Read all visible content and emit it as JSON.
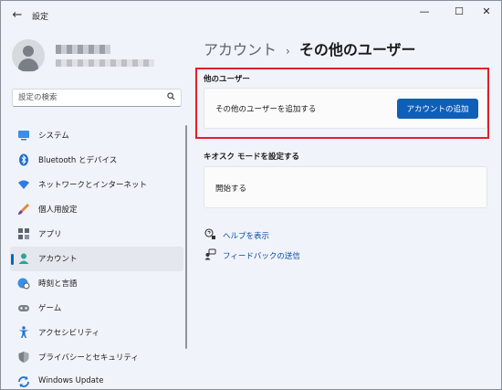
{
  "window": {
    "title": "設定",
    "back_glyph": "←",
    "minimize_glyph": "—",
    "maximize_glyph": "☐",
    "close_glyph": "✕"
  },
  "search": {
    "placeholder": "設定の検索"
  },
  "sidebar": {
    "items": [
      {
        "label": "システム",
        "icon": "monitor-icon"
      },
      {
        "label": "Bluetooth とデバイス",
        "icon": "bluetooth-icon"
      },
      {
        "label": "ネットワークとインターネット",
        "icon": "wifi-icon"
      },
      {
        "label": "個人用設定",
        "icon": "brush-icon"
      },
      {
        "label": "アプリ",
        "icon": "apps-icon"
      },
      {
        "label": "アカウント",
        "icon": "account-icon",
        "active": true
      },
      {
        "label": "時刻と言語",
        "icon": "globe-clock-icon"
      },
      {
        "label": "ゲーム",
        "icon": "gamepad-icon"
      },
      {
        "label": "アクセシビリティ",
        "icon": "accessibility-icon"
      },
      {
        "label": "プライバシーとセキュリティ",
        "icon": "shield-icon"
      },
      {
        "label": "Windows Update",
        "icon": "update-icon"
      }
    ]
  },
  "breadcrumb": {
    "parent": "アカウント",
    "separator": "›",
    "current": "その他のユーザー"
  },
  "other_users": {
    "title": "他のユーザー",
    "row_label": "その他のユーザーを追加する",
    "button_label": "アカウントの追加"
  },
  "kiosk": {
    "title": "キオスク モードを設定する",
    "row_label": "開始する"
  },
  "links": {
    "help": "ヘルプを表示",
    "feedback": "フィードバックの送信"
  },
  "colors": {
    "accent": "#0f5fb8",
    "highlight_box": "#e0202c"
  }
}
